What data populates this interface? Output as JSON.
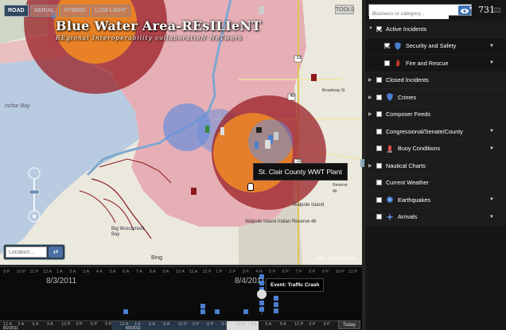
{
  "map": {
    "types": [
      "ROAD",
      "AERIAL",
      "HYBRID",
      "LOW LIGHT"
    ],
    "active_type": "ROAD",
    "tool_label": "TOOLS",
    "title": "Blue Water Area-REsILIeNT",
    "subtitle": "REgional Interoperability collaboratioN NeTwork",
    "tooltip": "St. Clair County WWT Plant",
    "watermark": "idv solutions",
    "location_placeholder": "Location...",
    "scale_label": "Bing",
    "place_labels": [
      "nchor Bay",
      "Big Muscamoot Bay",
      "Walpole Island",
      "Walpole Island Indian Reserve 46",
      "Indian",
      "Reserve",
      "46",
      "Broadway St"
    ],
    "road_shields": [
      "13",
      "13",
      "40"
    ]
  },
  "timeline": {
    "hours": [
      "9 P",
      "10 P",
      "11 P",
      "12 A",
      "1 A",
      "2 A",
      "3 A",
      "4 A",
      "5 A",
      "6 A",
      "7 A",
      "8 A",
      "9 A",
      "10 A",
      "11 A",
      "12 P",
      "1 P",
      "2 P",
      "3 P",
      "4 P",
      "5 P",
      "6 P",
      "7 P",
      "8 P",
      "9 P",
      "10 P",
      "11 P"
    ],
    "date_left": "8/3/2011",
    "date_right": "8/4/2011",
    "event_label": "Event: Traffic Crash",
    "bottom_ticks": [
      "12 A",
      "3 A",
      "6 A",
      "9 A",
      "12 P",
      "3 P",
      "6 P",
      "9 P",
      "12 A",
      "3 A",
      "6 A",
      "9 A",
      "12 P",
      "3 P",
      "6 P",
      "9 P",
      "12 A",
      "3 A",
      "6 A",
      "9 A",
      "12 P",
      "3 P",
      "6 P"
    ],
    "bottom_dates": [
      "8/2/2011",
      "8/3/2011",
      "8/4/2011"
    ],
    "today_label": "Today"
  },
  "panel": {
    "search_placeholder": "Business or category...",
    "count": "731",
    "count_sub": "TOTAL ITEMS",
    "layers": [
      {
        "label": "Active Incidents",
        "kind": "group",
        "arrow": "▼",
        "checked": true,
        "icon": "",
        "dropdown": false
      },
      {
        "label": "Security and Safety",
        "kind": "sub",
        "arrow": "",
        "checked": true,
        "icon": "shield-icon",
        "dropdown": true
      },
      {
        "label": "Fire and Rescue",
        "kind": "sub",
        "arrow": "",
        "checked": false,
        "icon": "fire-icon",
        "dropdown": true
      },
      {
        "label": "Closed Incidents",
        "kind": "group",
        "arrow": "▶",
        "checked": false,
        "icon": "",
        "dropdown": false
      },
      {
        "label": "Crimes",
        "kind": "group",
        "arrow": "▶",
        "checked": false,
        "icon": "crime-icon",
        "dropdown": false
      },
      {
        "label": "Composer Feeds",
        "kind": "group",
        "arrow": "▶",
        "checked": false,
        "icon": "",
        "dropdown": false
      },
      {
        "label": "Congressional/Senate/County",
        "kind": "group",
        "arrow": "",
        "checked": false,
        "icon": "",
        "dropdown": true
      },
      {
        "label": "Buoy Conditions",
        "kind": "group",
        "arrow": "",
        "checked": false,
        "icon": "buoy-icon",
        "dropdown": true
      },
      {
        "label": "Nautical Charts",
        "kind": "group",
        "arrow": "▶",
        "checked": false,
        "icon": "",
        "dropdown": false
      },
      {
        "label": "Current Weather",
        "kind": "group",
        "arrow": "",
        "checked": false,
        "icon": "",
        "dropdown": false
      },
      {
        "label": "Earthquakes",
        "kind": "group",
        "arrow": "",
        "checked": false,
        "icon": "earthquake-icon",
        "dropdown": true
      },
      {
        "label": "Arrivals",
        "kind": "group",
        "arrow": "",
        "checked": false,
        "icon": "plane-icon",
        "dropdown": true
      }
    ]
  },
  "colors": {
    "panel_bg": "#161616",
    "accent_blue": "#3e6fb1",
    "zone_red": "#a52a2a",
    "zone_orange": "#f08a24",
    "zone_blue": "#6a8fd8",
    "land_pink": "#e9b5b8"
  }
}
